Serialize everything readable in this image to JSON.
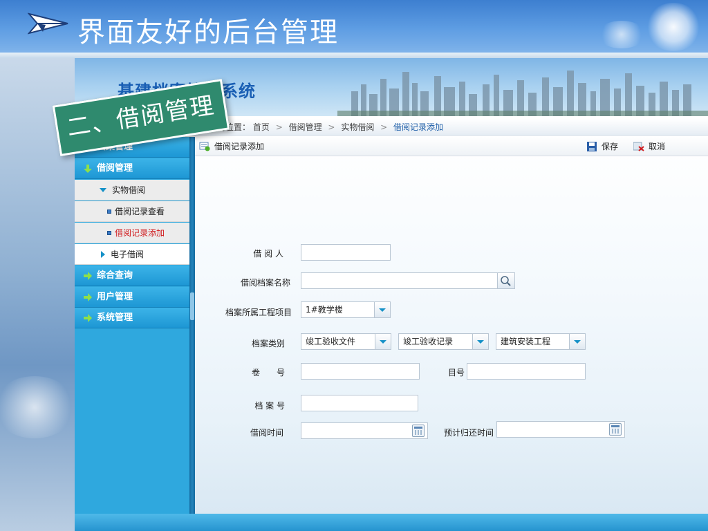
{
  "slide": {
    "title": "界面友好的后台管理",
    "section_label": "二、借阅管理"
  },
  "app": {
    "title": "基建档案管理系统",
    "breadcrumb": {
      "prefix": "当前位置：",
      "items": [
        "首页",
        "借阅管理",
        "实物借阅"
      ],
      "current": "借阅记录添加"
    },
    "sidebar": {
      "items": [
        {
          "label": "档案管理",
          "icon": "green-arrow-right-icon"
        },
        {
          "label": "借阅管理",
          "icon": "green-arrow-down-icon"
        },
        {
          "label": "实物借阅",
          "icon": "blue-triangle-down-icon"
        },
        {
          "label": "借阅记录查看",
          "icon": "blue-square-icon"
        },
        {
          "label": "借阅记录添加",
          "icon": "blue-square-icon",
          "active": true
        },
        {
          "label": "电子借阅",
          "icon": "blue-triangle-right-icon"
        },
        {
          "label": "综合查询",
          "icon": "green-arrow-right-icon"
        },
        {
          "label": "用户管理",
          "icon": "green-arrow-right-icon"
        },
        {
          "label": "系统管理",
          "icon": "green-arrow-right-icon"
        }
      ]
    },
    "toolbar": {
      "title": "借阅记录添加",
      "save_label": "保存",
      "cancel_label": "取消"
    },
    "form": {
      "borrower_label": "借 阅 人",
      "borrower_value": "",
      "archive_name_label": "借阅档案名称",
      "archive_name_value": "",
      "project_label": "档案所属工程项目",
      "project_value": "1#教学楼",
      "category_label": "档案类别",
      "category_value_1": "竣工验收文件",
      "category_value_2": "竣工验收记录",
      "category_value_3": "建筑安装工程",
      "volume_label": "卷　　号",
      "volume_value": "",
      "item_no_label": "目号",
      "item_no_value": "",
      "archive_no_label": "档 案 号",
      "archive_no_value": "",
      "borrow_time_label": "借阅时间",
      "borrow_time_value": "",
      "return_time_label": "预计归还时间",
      "return_time_value": ""
    }
  },
  "colors": {
    "sidebar_blue": "#1d97d4",
    "active_red": "#d0191c",
    "section_green": "#2f8a6e",
    "title_blue": "#1a5fb4"
  }
}
